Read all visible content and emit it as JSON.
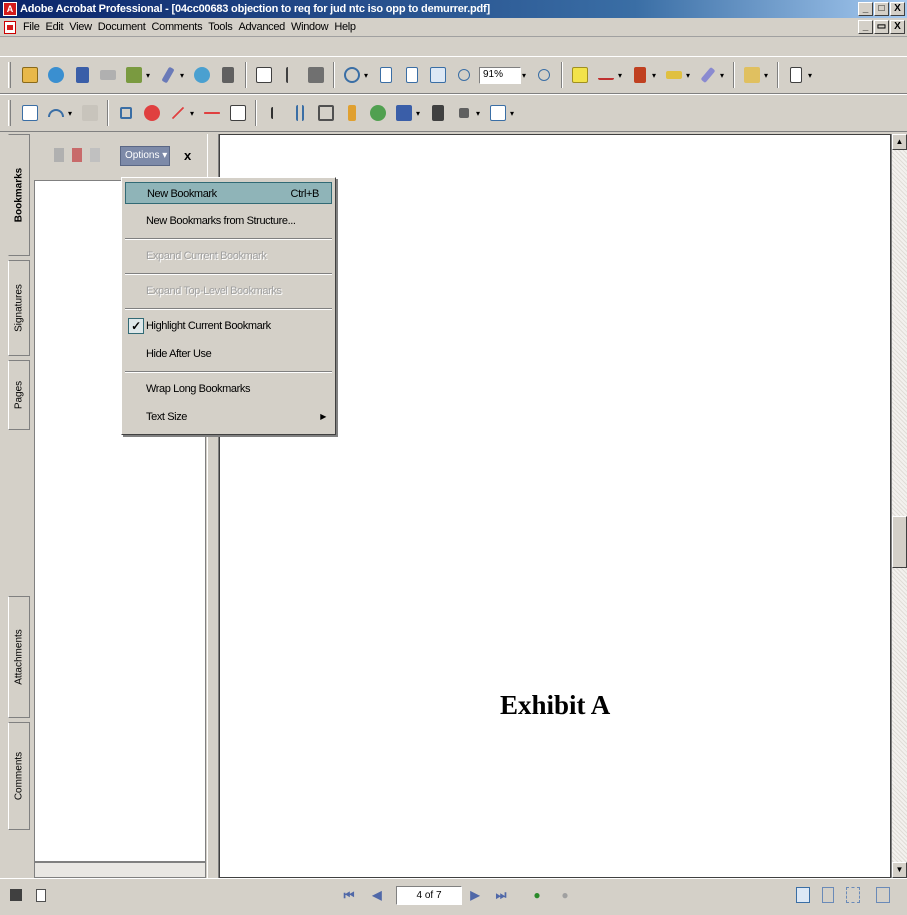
{
  "window": {
    "title": "Adobe Acrobat Professional - [04cc00683 objection to req for jud ntc iso opp to demurrer.pdf]",
    "controls": [
      "_",
      "□",
      "X"
    ],
    "doc_controls": [
      "_",
      "▭",
      "X"
    ]
  },
  "menubar": {
    "items": [
      "File",
      "Edit",
      "View",
      "Document",
      "Comments",
      "Tools",
      "Advanced",
      "Window",
      "Help"
    ]
  },
  "toolbar1": {
    "zoom_value": "91%",
    "icons": [
      "open-icon",
      "create-pdf-icon",
      "save-icon",
      "print-icon",
      "organizer-icon",
      "attach-icon",
      "email-icon",
      "search-icon",
      "hand-tool-icon",
      "select-text-icon",
      "snapshot-icon",
      "zoom-in-tool-icon",
      "actual-size-icon",
      "fit-page-icon",
      "fit-width-icon",
      "zoom-out-icon",
      "zoom-plus-icon",
      "comment-note-icon",
      "text-edits-icon",
      "stamp-icon",
      "highlight-icon",
      "pencil-markup-icon",
      "flag-icon",
      "export-icon"
    ]
  },
  "toolbar2": {
    "icons": [
      "spell-check-icon",
      "undo-icon",
      "paste-icon",
      "callout-icon",
      "oval-icon",
      "arrow-icon",
      "dimension-icon",
      "textbox-icon",
      "select-object-icon",
      "touchup-text-icon",
      "crop-icon",
      "link-icon",
      "3d-icon",
      "rectangle-icon",
      "movie-icon",
      "sound-icon",
      "form-field-icon"
    ]
  },
  "navpane": {
    "tabs": [
      "Bookmarks",
      "Signatures",
      "Pages",
      "Attachments",
      "Comments"
    ],
    "options_label": "Options",
    "close_label": "x"
  },
  "options_menu": {
    "items": [
      {
        "label": "New Bookmark",
        "shortcut": "Ctrl+B",
        "state": "selected"
      },
      {
        "label": "New Bookmarks from Structure...",
        "state": "normal"
      },
      {
        "label": "Expand Current Bookmark",
        "state": "disabled"
      },
      {
        "label": "Expand Top-Level Bookmarks",
        "state": "disabled"
      },
      {
        "label": "Highlight Current Bookmark",
        "state": "checked"
      },
      {
        "label": "Hide After Use",
        "state": "normal"
      },
      {
        "label": "Wrap Long Bookmarks",
        "state": "normal"
      },
      {
        "label": "Text Size",
        "state": "submenu"
      }
    ]
  },
  "document": {
    "heading": "Exhibit A"
  },
  "statusbar": {
    "page_indicator": "4 of 7"
  },
  "colors": {
    "titlebar": "#0a246a",
    "menu_highlight": "#8fb4b8",
    "options_button": "#7d8aa8"
  }
}
